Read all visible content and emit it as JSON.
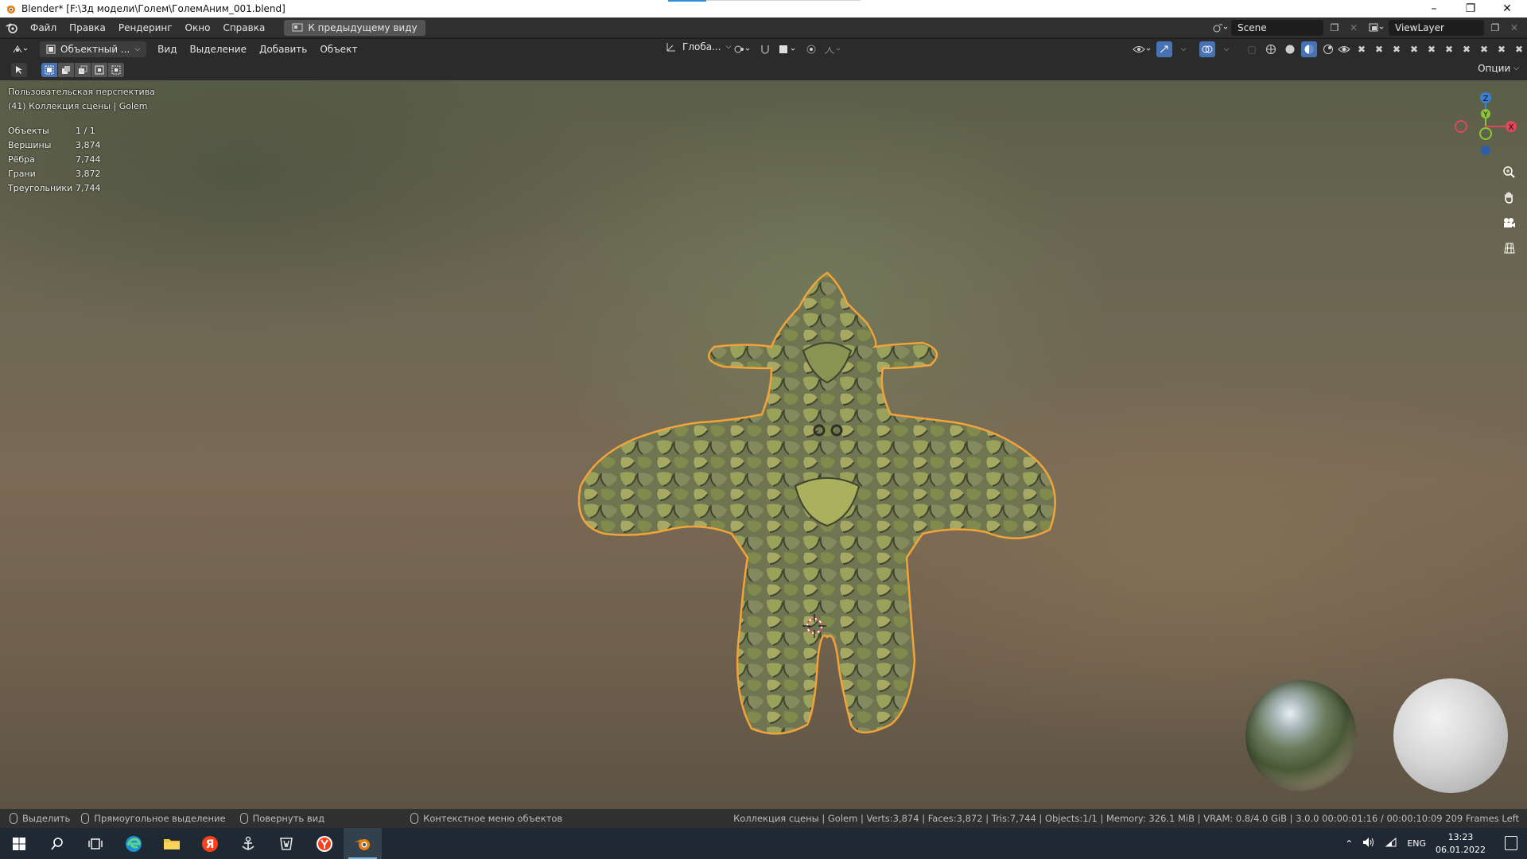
{
  "window": {
    "title": "Blender* [F:\\3д модели\\Голем\\ГолемАним_001.blend]",
    "controls": [
      "minimize",
      "maximize",
      "close"
    ]
  },
  "topbar": {
    "menus": [
      "Файл",
      "Правка",
      "Рендеринг",
      "Окно",
      "Справка"
    ],
    "prev_view_label": "К предыдущему виду",
    "scene_name": "Scene",
    "view_layer": "ViewLayer"
  },
  "viewport_header": {
    "mode_label": "Объектный ...",
    "menus": [
      "Вид",
      "Выделение",
      "Добавить",
      "Объект"
    ],
    "transform_orientation": "Глоба...",
    "options_label": "Опции"
  },
  "viewport": {
    "view_name": "Пользовательская перспектива",
    "collection_info": "(41) Коллекция сцены | Golem",
    "stats": [
      {
        "label": "Объекты",
        "value": "1 / 1"
      },
      {
        "label": "Вершины",
        "value": "3,874"
      },
      {
        "label": "Рёбра",
        "value": "7,744"
      },
      {
        "label": "Грани",
        "value": "3,872"
      },
      {
        "label": "Треугольники",
        "value": "7,744"
      }
    ],
    "gizmo_axes": [
      "Z",
      "Y",
      "X"
    ],
    "side_tools": [
      "zoom-icon",
      "hand-pan-icon",
      "camera-icon",
      "grid-ortho-icon"
    ],
    "colors": {
      "selection_outline": "#f2a33a",
      "axis_x": "#e0465a",
      "axis_y": "#8cc43a",
      "axis_z": "#3b7ed8"
    }
  },
  "statusbar": {
    "hints": [
      {
        "icon": "mouse-left-icon",
        "label": "Выделить"
      },
      {
        "icon": "mouse-middle-icon",
        "label": "Прямоугольное выделение"
      },
      {
        "icon": "mouse-right-icon",
        "label": "Повернуть вид"
      },
      {
        "icon": "mouse-right-icon",
        "label": "Контекстное меню объектов"
      }
    ],
    "info": "Коллекция сцены | Golem | Verts:3,874 | Faces:3,872 | Tris:7,744 | Objects:1/1 | Memory: 326.1 MiB | VRAM: 0.8/4.0 GiB | 3.0.0   00:00:01:16 / 00:00:10:09  209 Frames Left"
  },
  "taskbar": {
    "apps": [
      "windows-start-icon",
      "search-icon",
      "task-view-icon",
      "edge-icon",
      "file-explorer-icon",
      "yandex-icon",
      "world-of-warships-icon",
      "world-of-tanks-icon",
      "yandex-browser-icon",
      "blender-icon"
    ],
    "language": "ENG",
    "time": "13:23",
    "date": "06.01.2022"
  }
}
